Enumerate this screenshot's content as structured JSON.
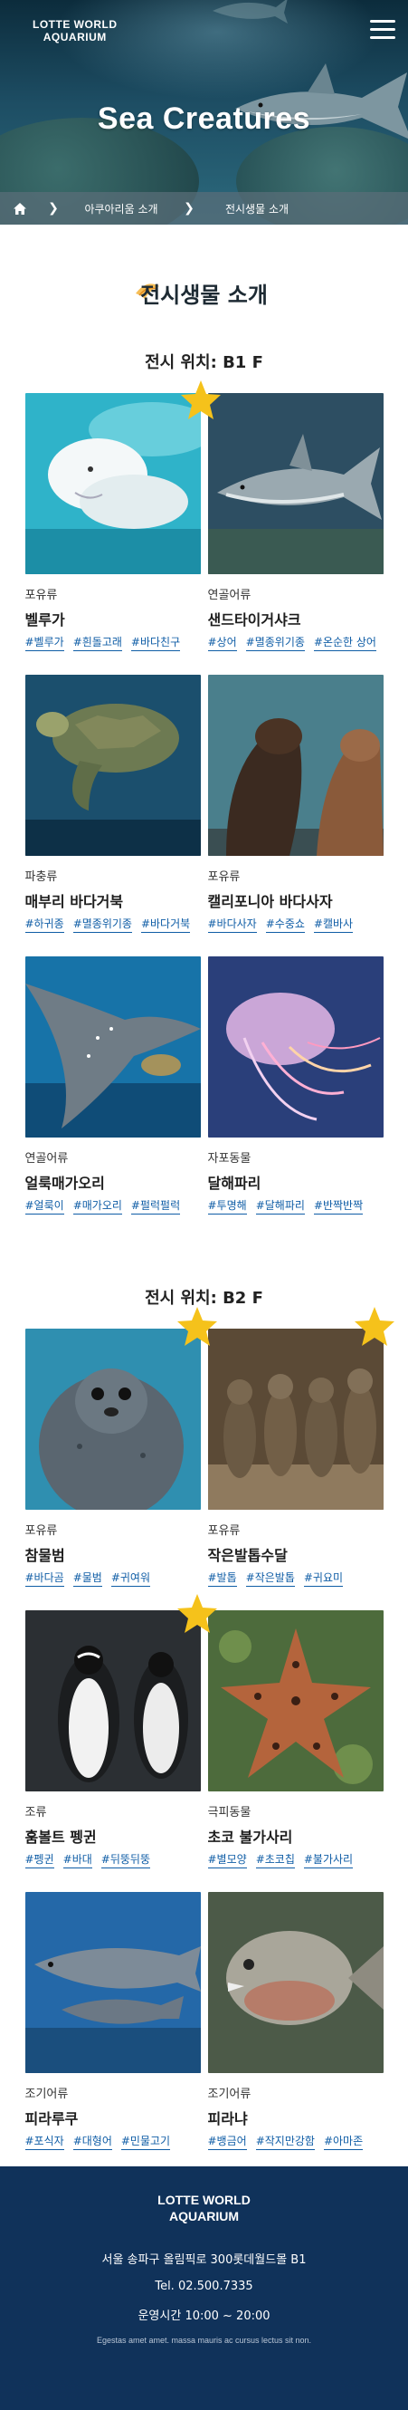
{
  "header": {
    "logo_line1": "LOTTE WORLD",
    "logo_line2": "AQUARIUM",
    "hero_title": "Sea Creatures"
  },
  "breadcrumb": [
    "아쿠아리움 소개",
    "전시생물 소개"
  ],
  "section_title": "전시생물 소개",
  "floors": [
    {
      "label": "전시 위치: B1 F",
      "items": [
        {
          "category": "포유류",
          "name": "벨루가",
          "tags": [
            "#벨루가",
            "#흰돌고래",
            "#바다친구"
          ]
        },
        {
          "category": "연골어류",
          "name": "샌드타이거샤크",
          "tags": [
            "#상어",
            "#멸종위기종",
            "#온순한 상어"
          ]
        },
        {
          "category": "파충류",
          "name": "매부리 바다거북",
          "tags": [
            "#하귀종",
            "#멸종위기종",
            "#바다거북"
          ]
        },
        {
          "category": "포유류",
          "name": "캘리포니아 바다사자",
          "tags": [
            "#바다사자",
            "#수중쇼",
            "#캘바사"
          ]
        },
        {
          "category": "연골어류",
          "name": "얼룩매가오리",
          "tags": [
            "#얼룩이",
            "#매가오리",
            "#펄럭펄럭"
          ]
        },
        {
          "category": "자포동물",
          "name": "달해파리",
          "tags": [
            "#투명해",
            "#달해파리",
            "#반짝반짝"
          ]
        }
      ]
    },
    {
      "label": "전시 위치: B2 F",
      "items": [
        {
          "category": "포유류",
          "name": "참물범",
          "tags": [
            "#바다곰",
            "#물범",
            "#귀여워"
          ]
        },
        {
          "category": "포유류",
          "name": "작은발톱수달",
          "tags": [
            "#발톱",
            "#작은발톱",
            "#귀요미"
          ]
        },
        {
          "category": "조류",
          "name": "훔볼트 펭귄",
          "tags": [
            "#펭귄",
            "#바대",
            "#뒤뚱뒤뚱"
          ]
        },
        {
          "category": "극피동물",
          "name": "초코 불가사리",
          "tags": [
            "#별모양",
            "#초코칩",
            "#불가사리"
          ]
        },
        {
          "category": "조기어류",
          "name": "피라루쿠",
          "tags": [
            "#포식자",
            "#대형어",
            "#민물고기"
          ]
        },
        {
          "category": "조기어류",
          "name": "피라냐",
          "tags": [
            "#뱅금어",
            "#작지만강함",
            "#아마존"
          ]
        }
      ]
    }
  ],
  "footer": {
    "logo_line1": "LOTTE WORLD",
    "logo_line2": "AQUARIUM",
    "address": "서울 송파구 올림픽로 300롯데월드몰 B1",
    "tel": "Tel. 02.500.7335",
    "hours": "운영시간 10:00 ~ 20:00",
    "note": "Egestas amet amet. massa mauris ac cursus lectus sit non."
  },
  "colors": {
    "accent": "#0f5da6",
    "footer": "#10325a",
    "star": "#f5c21b"
  }
}
